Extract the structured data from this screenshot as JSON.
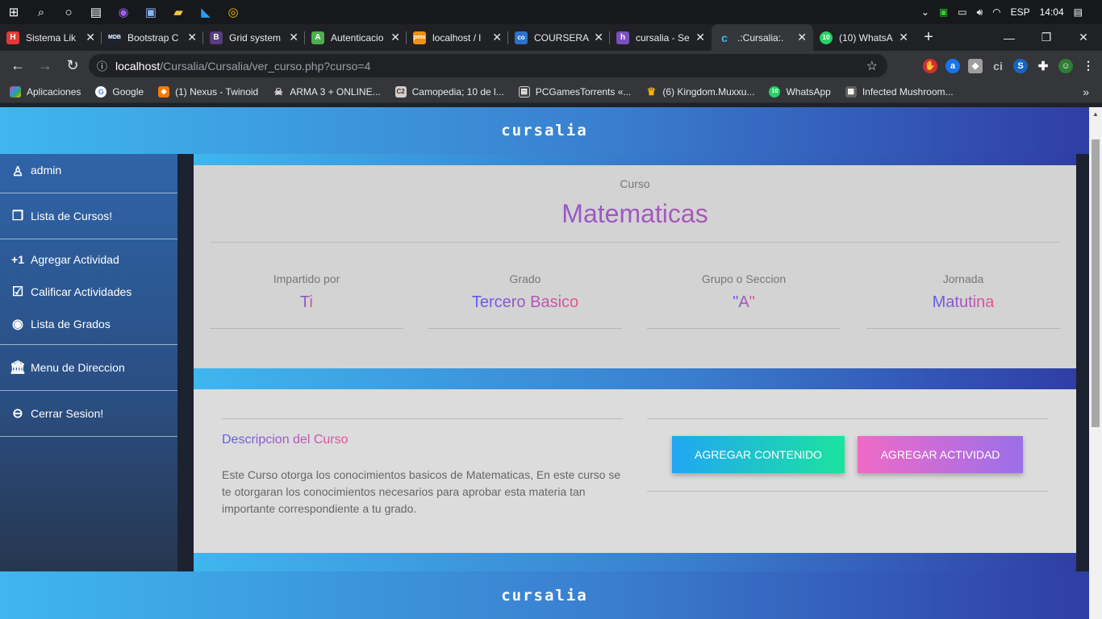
{
  "taskbar": {
    "lang": "ESP",
    "time": "14:04"
  },
  "tabs": [
    {
      "title": "Sistema Lik",
      "favicon": "H",
      "color": "#e53935"
    },
    {
      "title": "Bootstrap C",
      "favicon": "MDB",
      "color": "#1c2331"
    },
    {
      "title": "Grid system",
      "favicon": "B",
      "color": "#563d7c"
    },
    {
      "title": "Autenticacio",
      "favicon": "A",
      "color": "#4caf50"
    },
    {
      "title": "localhost / l",
      "favicon": "pma",
      "color": "#f29111"
    },
    {
      "title": "COURSERA",
      "favicon": "co",
      "color": "#2a73cc"
    },
    {
      "title": "cursalia - Se",
      "favicon": "h",
      "color": "#7b4fbf"
    },
    {
      "title": ".:Cursalia:.",
      "favicon": "c",
      "color": "#3fb6ee"
    },
    {
      "title": "(10) WhatsA",
      "favicon": "10",
      "color": "#25d366"
    }
  ],
  "address": {
    "host": "localhost",
    "path": "/Cursalia/Cursalia/ver_curso.php?curso=4"
  },
  "bookmarks": [
    {
      "label": "Aplicaciones",
      "color": "#ea4335"
    },
    {
      "label": "Google",
      "color": "#4285f4"
    },
    {
      "label": "(1) Nexus - Twinoid",
      "color": "#f57c00"
    },
    {
      "label": "ARMA 3 + ONLINE...",
      "color": "#555555"
    },
    {
      "label": "Camopedia; 10 de l...",
      "color": "#d7ccc8"
    },
    {
      "label": "PCGamesTorrents «...",
      "color": "#424242"
    },
    {
      "label": "(6) Kingdom.Muxxu...",
      "color": "#ffb300"
    },
    {
      "label": "WhatsApp",
      "color": "#25d366"
    },
    {
      "label": "Infected Mushroom...",
      "color": "#616161"
    }
  ],
  "site": {
    "logo": "cursalia"
  },
  "sidebar": {
    "user": "admin",
    "lista_cursos": "Lista de Cursos!",
    "agregar_actividad": "Agregar Actividad",
    "calificar": "Calificar Actividades",
    "lista_grados": "Lista de Grados",
    "menu_direccion": "Menu de Direccion",
    "cerrar": "Cerrar Sesion!"
  },
  "course": {
    "label": "Curso",
    "title": "Matematicas",
    "info": [
      {
        "label": "Impartido por",
        "value": "Ti"
      },
      {
        "label": "Grado",
        "value": "Tercero Basico"
      },
      {
        "label": "Grupo o Seccion",
        "value": "\"A\""
      },
      {
        "label": "Jornada",
        "value": "Matutina"
      }
    ],
    "desc_title": "Descripcion del Curso",
    "desc_text": "Este Curso otorga los conocimientos basicos de Matematicas, En este curso se te otorgaran los conocimientos necesarios para aprobar esta materia tan importante correspondiente a tu grado.",
    "btn_contenido": "AGREGAR CONTENIDO",
    "btn_actividad": "AGREGAR ACTIVIDAD"
  }
}
